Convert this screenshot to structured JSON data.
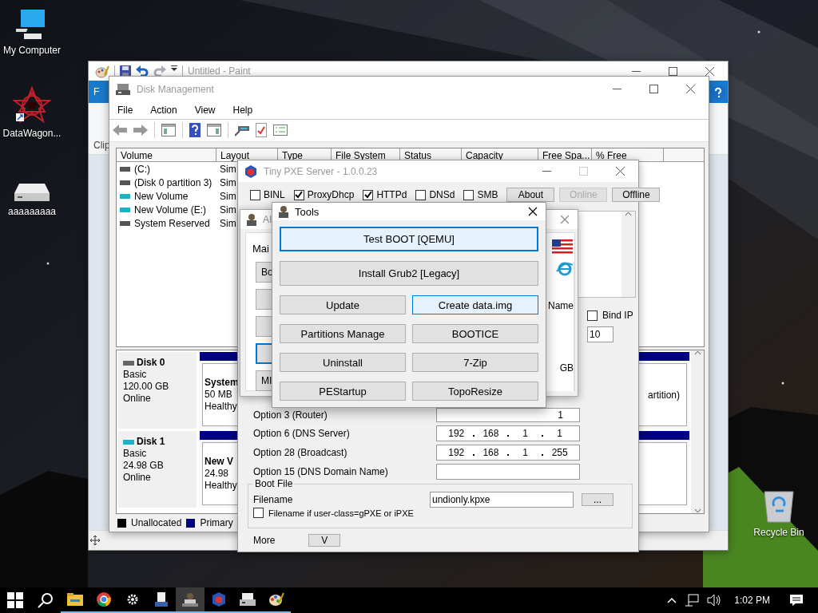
{
  "desktop_icons": [
    {
      "label": "My Computer",
      "kind": "computer"
    },
    {
      "label": "DataWagon...",
      "kind": "shortcut"
    },
    {
      "label": "aaaaaaaaa",
      "kind": "drive"
    },
    {
      "label": "Recycle Bin",
      "kind": "bin"
    }
  ],
  "paint": {
    "title": "Untitled - Paint",
    "ribbon_tab": "F",
    "group_label": "Clip"
  },
  "disk_management": {
    "title": "Disk Management",
    "menu": [
      "File",
      "Action",
      "View",
      "Help"
    ],
    "columns": [
      "Volume",
      "Layout",
      "Type",
      "File System",
      "Status",
      "Capacity",
      "Free Spa...",
      "% Free"
    ],
    "volumes": [
      {
        "volume": "(C:)",
        "layout": "Sim",
        "kind": "fixed"
      },
      {
        "volume": "(Disk 0 partition 3)",
        "layout": "Sim",
        "kind": "fixed"
      },
      {
        "volume": "New Volume",
        "layout": "Sim",
        "kind": "removable"
      },
      {
        "volume": "New Volume (E:)",
        "layout": "Sim",
        "kind": "removable"
      },
      {
        "volume": "System Reserved",
        "layout": "Sim",
        "kind": "fixed"
      }
    ],
    "disks": [
      {
        "name": "Disk 0",
        "type": "Basic",
        "size": "120.00 GB",
        "status": "Online",
        "kind": "fixed",
        "partition": {
          "name": "System",
          "size": "50 MB",
          "health": "Healthy"
        },
        "tail": "artition)"
      },
      {
        "name": "Disk 1",
        "type": "Basic",
        "size": "24.98 GB",
        "status": "Online",
        "kind": "removable",
        "partition": {
          "name": "New V",
          "size": "24.98",
          "health": "Healthy"
        }
      }
    ],
    "legend": [
      {
        "label": "Unallocated",
        "color": "#000000"
      },
      {
        "label": "Primary",
        "color": "#000080"
      }
    ]
  },
  "pxe": {
    "title": "Tiny PXE Server - 1.0.0.23",
    "services": [
      {
        "label": "BINL",
        "checked": false
      },
      {
        "label": "ProxyDhcp",
        "checked": true
      },
      {
        "label": "HTTPd",
        "checked": true
      },
      {
        "label": "DNSd",
        "checked": false
      },
      {
        "label": "SMB",
        "checked": false
      }
    ],
    "buttons": [
      {
        "label": "About",
        "disabled": false
      },
      {
        "label": "Online",
        "disabled": true
      },
      {
        "label": "Offline",
        "disabled": false
      }
    ],
    "bind_ip": {
      "label": "Bind IP",
      "checked": false,
      "value": "10"
    },
    "options": [
      {
        "label": "Option 3 (Router)",
        "octets": [
          "1"
        ]
      },
      {
        "label": "Option 6  (DNS Server)",
        "octets": [
          "192",
          "168",
          "1",
          "1"
        ]
      },
      {
        "label": "Option 28 (Broadcast)",
        "octets": [
          "192",
          "168",
          "1",
          "255"
        ]
      },
      {
        "label": "Option 15 (DNS Domain Name)"
      }
    ],
    "boot_file": {
      "group": "Boot File",
      "label": "Filename",
      "value": "undionly.kpxe",
      "browse": "...",
      "alt_label": "Filename if user-class=gPXE or iPXE",
      "alt_checked": false
    },
    "more": {
      "label": "More",
      "button": "V"
    }
  },
  "aio": {
    "title": "AI",
    "tab": "Mai",
    "side_buttons": [
      {
        "label": "Bo",
        "focused": false
      },
      {
        "focused": false
      },
      {
        "focused": false
      },
      {
        "focused": true
      },
      {
        "label": "MI",
        "focused": false
      }
    ],
    "texts": [
      "Name",
      "GB"
    ]
  },
  "tools": {
    "title": "Tools",
    "buttons": [
      {
        "label": "Test BOOT [QEMU]",
        "wide": true,
        "focused": true,
        "hovered": false
      },
      {
        "label": "Install Grub2 [Legacy]",
        "wide": true,
        "focused": false,
        "hovered": false
      },
      {
        "label": "Update",
        "wide": false,
        "focused": false,
        "hovered": false
      },
      {
        "label": "Create data.img",
        "wide": false,
        "focused": false,
        "hovered": true
      },
      {
        "label": "Partitions Manage",
        "wide": false,
        "focused": false,
        "hovered": false
      },
      {
        "label": "BOOTICE",
        "wide": false,
        "focused": false,
        "hovered": false
      },
      {
        "label": "Uninstall",
        "wide": false,
        "focused": false,
        "hovered": false
      },
      {
        "label": "7-Zip",
        "wide": false,
        "focused": false,
        "hovered": false
      },
      {
        "label": "PEStartup",
        "wide": false,
        "focused": false,
        "hovered": false
      },
      {
        "label": "TopoResize",
        "wide": false,
        "focused": false,
        "hovered": false
      }
    ]
  },
  "taskbar": {
    "apps": [
      {
        "kind": "folder",
        "selected": false
      },
      {
        "kind": "browser",
        "selected": false
      },
      {
        "kind": "gear",
        "selected": false
      },
      {
        "kind": "server",
        "selected": false
      },
      {
        "kind": "person",
        "selected": true
      },
      {
        "kind": "cube",
        "selected": false
      },
      {
        "kind": "drive",
        "selected": false
      },
      {
        "kind": "palette",
        "selected": false
      }
    ],
    "time": "1:02 PM"
  }
}
